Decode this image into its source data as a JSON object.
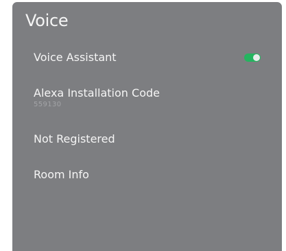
{
  "panel": {
    "title": "Voice"
  },
  "items": [
    {
      "label": "Voice Assistant",
      "toggle": {
        "state": "on",
        "color": "#24b45f"
      }
    },
    {
      "label": "Alexa Installation Code",
      "sub": "559130"
    },
    {
      "label": "Not Registered"
    },
    {
      "label": "Room Info"
    }
  ],
  "colors": {
    "panel_bg": "#7d7e81",
    "text": "#f5f5f5",
    "subtext": "#a3a4a7",
    "accent": "#24b45f"
  }
}
